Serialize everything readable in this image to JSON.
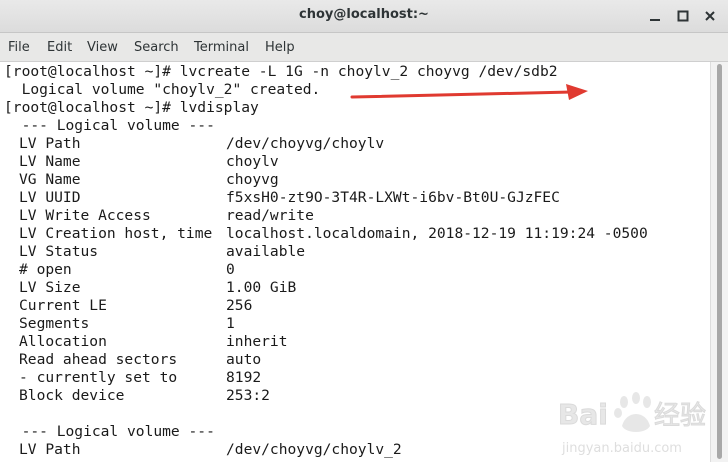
{
  "window": {
    "title": "choy@localhost:~",
    "controls": [
      "minimize-icon",
      "maximize-icon",
      "close-icon"
    ]
  },
  "menu": {
    "items": [
      "File",
      "Edit",
      "View",
      "Search",
      "Terminal",
      "Help"
    ]
  },
  "terminal": {
    "cmd1": "[root@localhost ~]# lvcreate -L 1G -n choylv_2 choyvg /dev/sdb2",
    "out1": "  Logical volume \"choylv_2\" created.",
    "cmd2": "[root@localhost ~]# lvdisplay",
    "header1": "  --- Logical volume ---",
    "rows": [
      {
        "key": "LV Path",
        "value": "/dev/choyvg/choylv"
      },
      {
        "key": "LV Name",
        "value": "choylv"
      },
      {
        "key": "VG Name",
        "value": "choyvg"
      },
      {
        "key": "LV UUID",
        "value": "f5xsH0-zt9O-3T4R-LXWt-i6bv-Bt0U-GJzFEC"
      },
      {
        "key": "LV Write Access",
        "value": "read/write"
      },
      {
        "key": "LV Creation host, time",
        "value": "localhost.localdomain, 2018-12-19 11:19:24 -0500"
      },
      {
        "key": "LV Status",
        "value": "available"
      },
      {
        "key": "# open",
        "value": "0"
      },
      {
        "key": "LV Size",
        "value": "1.00 GiB"
      },
      {
        "key": "Current LE",
        "value": "256"
      },
      {
        "key": "Segments",
        "value": "1"
      },
      {
        "key": "Allocation",
        "value": "inherit"
      },
      {
        "key": "Read ahead sectors",
        "value": "auto"
      },
      {
        "key": "- currently set to",
        "value": "8192"
      },
      {
        "key": "Block device",
        "value": "253:2"
      }
    ],
    "header2": "  --- Logical volume ---",
    "row2": {
      "key": "LV Path",
      "value": "/dev/choyvg/choylv_2"
    }
  },
  "annotation": {
    "color": "#e03a30",
    "icon": "red-arrow-icon"
  },
  "watermark": {
    "text": "Baidu 经验",
    "subtext": "jingyan.baidu.com"
  }
}
